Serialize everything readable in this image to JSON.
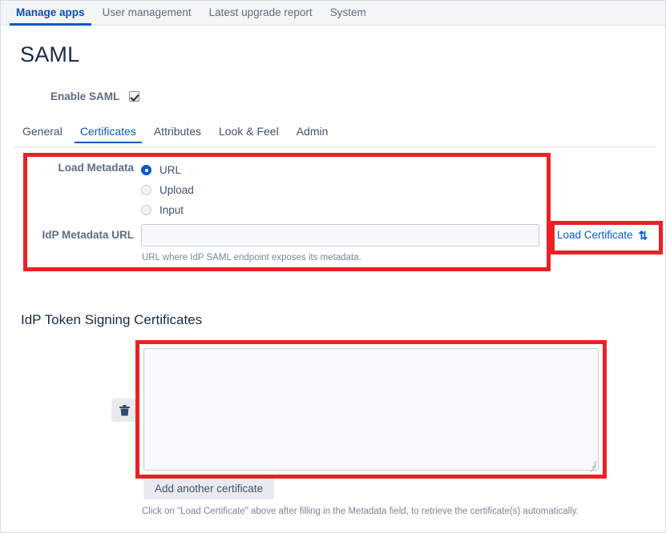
{
  "topnav": {
    "tabs": [
      {
        "label": "Manage apps",
        "active": true
      },
      {
        "label": "User management",
        "active": false
      },
      {
        "label": "Latest upgrade report",
        "active": false
      },
      {
        "label": "System",
        "active": false
      }
    ]
  },
  "page": {
    "title": "SAML"
  },
  "enable_saml": {
    "label": "Enable SAML",
    "checked": true
  },
  "subtabs": {
    "tabs": [
      {
        "label": "General",
        "active": false
      },
      {
        "label": "Certificates",
        "active": true
      },
      {
        "label": "Attributes",
        "active": false
      },
      {
        "label": "Look & Feel",
        "active": false
      },
      {
        "label": "Admin",
        "active": false
      }
    ]
  },
  "metadata_form": {
    "load_metadata_label": "Load Metadata",
    "options": [
      {
        "label": "URL",
        "selected": true
      },
      {
        "label": "Upload",
        "selected": false
      },
      {
        "label": "Input",
        "selected": false
      }
    ],
    "idp_url_label": "IdP Metadata URL",
    "idp_url_value": "",
    "idp_url_placeholder": "",
    "hint": "URL where IdP SAML endpoint exposes its metadata.",
    "load_certificate_label": "Load Certificate",
    "load_certificate_icon": "up-down-arrows-icon",
    "load_certificate_glyph": "⇅"
  },
  "certificates": {
    "section_title": "IdP Token Signing Certificates",
    "delete_icon": "trash-icon",
    "certificate_value": "",
    "certificate_placeholder": "",
    "add_button_label": "Add another certificate",
    "hint": "Click on \"Load Certificate\" above after filling in the Metadata field, to retrieve the certificate(s) automatically."
  },
  "colors": {
    "accent_blue": "#0b58c9",
    "annotation_red": "#ed2024",
    "heading_navy": "#172b4d",
    "text_gray": "#42526e",
    "panel_gray": "#f4f5f7"
  }
}
